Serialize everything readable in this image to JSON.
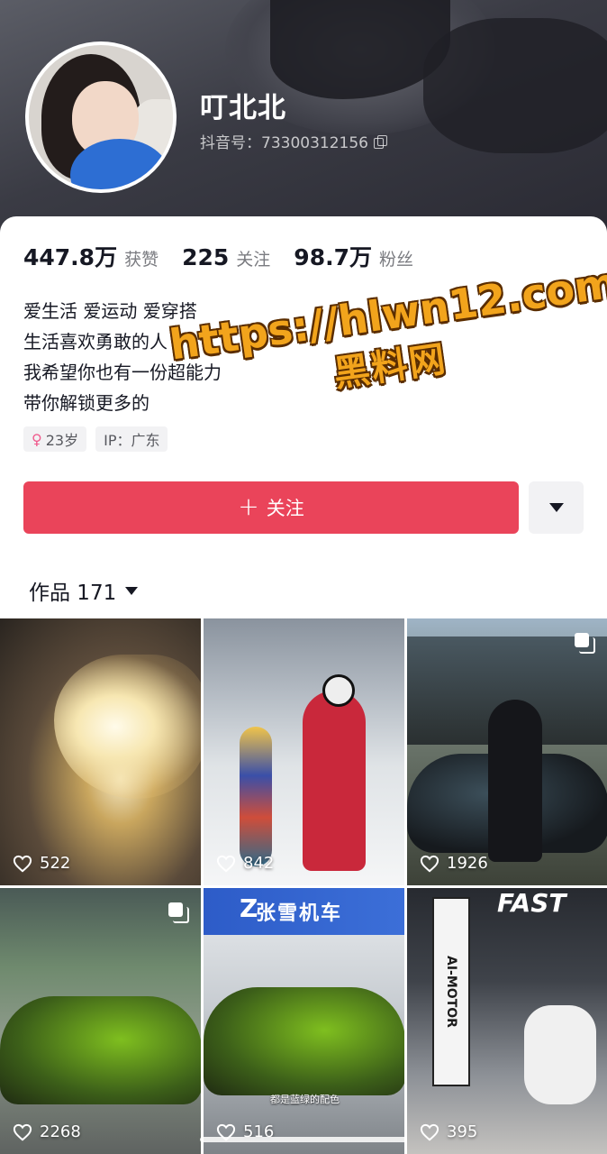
{
  "profile": {
    "nickname": "叮北北",
    "douyin_id": "抖音号：73300312156"
  },
  "stats": [
    {
      "value": "447.8万",
      "label": "获赞"
    },
    {
      "value": "225",
      "label": "关注"
    },
    {
      "value": "98.7万",
      "label": "粉丝"
    }
  ],
  "bio": [
    "爱生活 爱运动 爱穿搭",
    "生活喜欢勇敢的人",
    "我希望你也有一份超能力",
    "带你解锁更多的"
  ],
  "tags": {
    "age": "23岁",
    "ip": "IP：广东"
  },
  "actions": {
    "follow_label": "关注"
  },
  "works": {
    "label": "作品 171"
  },
  "grid": [
    {
      "likes": "522"
    },
    {
      "likes": "842"
    },
    {
      "likes": "1926"
    },
    {
      "likes": "2268"
    },
    {
      "likes": "516",
      "caption": "都是蓝绿的配色"
    },
    {
      "likes": "395"
    }
  ],
  "tile_text": {
    "shop_sign": "张雪机车",
    "flag": "AI-MOTOR",
    "fast": "FAST"
  },
  "watermark": {
    "url": "https://hlwn12.com",
    "name": "黑料网"
  },
  "colors": {
    "accent": "#ea445a",
    "watermark": "#f2a41c"
  }
}
